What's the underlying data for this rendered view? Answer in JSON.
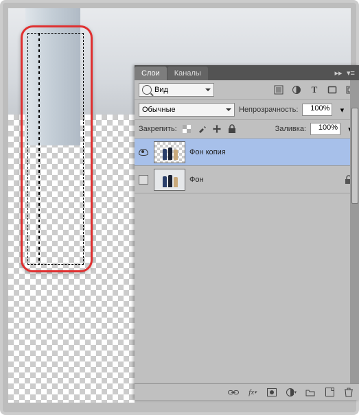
{
  "tabs": {
    "layers": "Слои",
    "channels": "Каналы"
  },
  "filter": {
    "kind_label": "Вид"
  },
  "blend": {
    "mode": "Обычные",
    "opacity_label": "Непрозрачность:",
    "opacity_value": "100%"
  },
  "lock": {
    "label": "Закрепить:",
    "fill_label": "Заливка:",
    "fill_value": "100%"
  },
  "layers": [
    {
      "name": "Фон копия",
      "visible": true,
      "selected": true,
      "locked": false
    },
    {
      "name": "Фон",
      "visible": false,
      "selected": false,
      "locked": true
    }
  ],
  "icons": {
    "filter_pixel": "pixel-filter-icon",
    "filter_adjust": "adjustment-filter-icon",
    "filter_type": "type-filter-icon",
    "filter_shape": "shape-filter-icon",
    "filter_smart": "smart-filter-icon",
    "lock_trans": "lock-transparency-icon",
    "lock_paint": "lock-paint-icon",
    "lock_move": "lock-move-icon",
    "lock_all": "lock-all-icon",
    "link": "link-icon",
    "fx": "fx-icon",
    "mask": "mask-icon",
    "adjust": "adjustment-layer-icon",
    "group": "group-icon",
    "new": "new-layer-icon",
    "trash": "trash-icon"
  }
}
